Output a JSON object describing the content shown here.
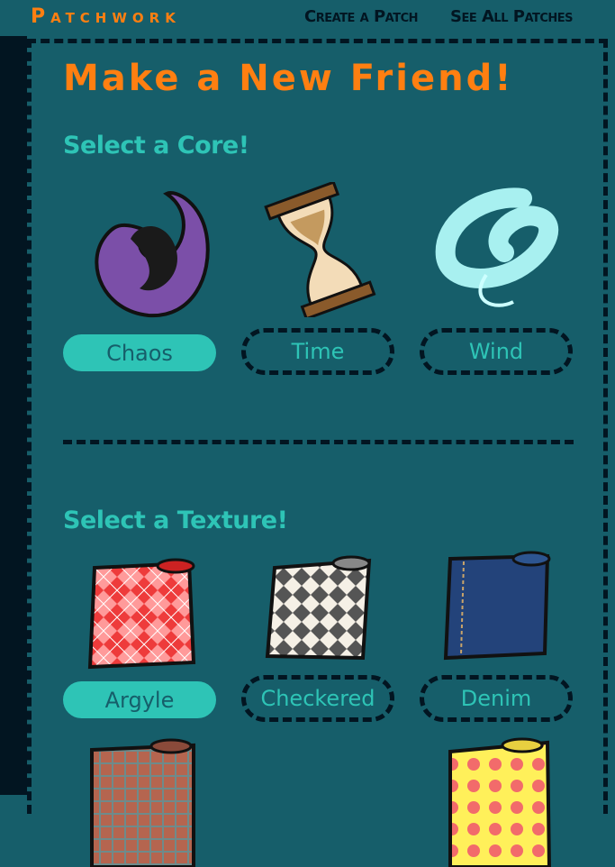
{
  "header": {
    "logo": "Patchwork",
    "nav": [
      "Create a Patch",
      "See All Patches"
    ]
  },
  "title": "Make a New Friend!",
  "core": {
    "heading": "Select a Core!",
    "options": [
      {
        "label": "Chaos",
        "selected": true
      },
      {
        "label": "Time",
        "selected": false
      },
      {
        "label": "Wind",
        "selected": false
      }
    ]
  },
  "texture": {
    "heading": "Select a Texture!",
    "options": [
      {
        "label": "Argyle",
        "selected": true
      },
      {
        "label": "Checkered",
        "selected": false
      },
      {
        "label": "Denim",
        "selected": false
      }
    ]
  },
  "colors": {
    "accent": "#2ec4b6",
    "orange": "#ff7f11",
    "bg": "#165e6a",
    "dark": "#021521"
  }
}
